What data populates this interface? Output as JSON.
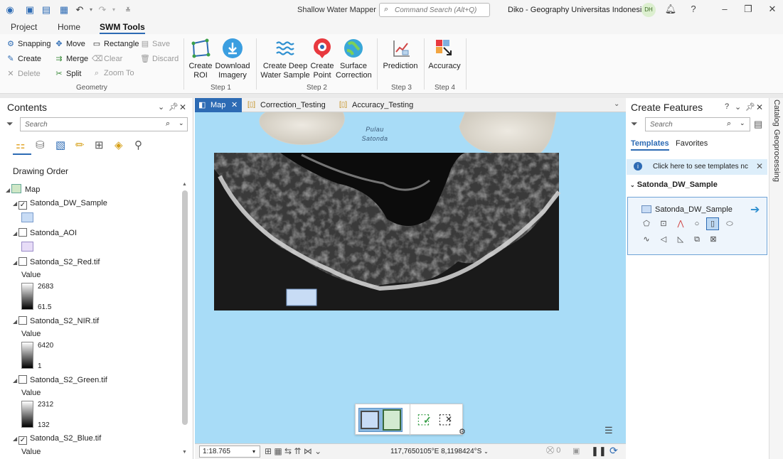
{
  "app": {
    "title": "Shallow Water Mapper",
    "command_search_placeholder": "Command Search (Alt+Q)",
    "user_name": "Diko - Geography Universitas Indonesia",
    "user_initials": "DH"
  },
  "ribbon_tabs": [
    "Project",
    "Home",
    "SWM Tools"
  ],
  "geometry_group": {
    "label": "Geometry",
    "items": [
      {
        "label": "Snapping",
        "glyph": "⚙"
      },
      {
        "label": "Move",
        "glyph": "✥"
      },
      {
        "label": "Rectangle",
        "glyph": "▭"
      },
      {
        "label": "Save",
        "glyph": "💾"
      },
      {
        "label": "Create",
        "glyph": "✎"
      },
      {
        "label": "Merge",
        "glyph": "⇉"
      },
      {
        "label": "Clear",
        "glyph": "⌫"
      },
      {
        "label": "Discard",
        "glyph": "🗑"
      },
      {
        "label": "Delete",
        "glyph": "✕"
      },
      {
        "label": "Split",
        "glyph": "✂"
      },
      {
        "label": "Zoom To",
        "glyph": "⌕"
      }
    ]
  },
  "steps": [
    {
      "label": "Step 1",
      "buttons": [
        "Create ROI",
        "Download Imagery"
      ]
    },
    {
      "label": "Step 2",
      "buttons": [
        "Create Deep Water Sample",
        "Create Point",
        "Surface Correction"
      ]
    },
    {
      "label": "Step 3",
      "buttons": [
        "Prediction"
      ]
    },
    {
      "label": "Step 4",
      "buttons": [
        "Accuracy"
      ]
    }
  ],
  "ribbon_buttons": {
    "create_roi": [
      "Create",
      "ROI"
    ],
    "download_imagery": [
      "Download",
      "Imagery"
    ],
    "create_deep_water": [
      "Create Deep",
      "Water Sample"
    ],
    "create_point": [
      "Create",
      "Point"
    ],
    "surface_correction": [
      "Surface",
      "Correction"
    ],
    "prediction": "Prediction",
    "accuracy": "Accuracy"
  },
  "contents": {
    "title": "Contents",
    "search_placeholder": "Search",
    "drawing_order_label": "Drawing Order",
    "map_label": "Map",
    "layers": [
      {
        "name": "Satonda_DW_Sample",
        "checked": true
      },
      {
        "name": "Satonda_AOI",
        "checked": false
      },
      {
        "name": "Satonda_S2_Red.tif",
        "checked": false,
        "value_label": "Value",
        "max": "2683",
        "min": "61.5"
      },
      {
        "name": "Satonda_S2_NIR.tif",
        "checked": false,
        "value_label": "Value",
        "max": "6420",
        "min": "1"
      },
      {
        "name": "Satonda_S2_Green.tif",
        "checked": false,
        "value_label": "Value",
        "max": "2312",
        "min": "132"
      },
      {
        "name": "Satonda_S2_Blue.tif",
        "checked": true,
        "value_label": "Value"
      }
    ]
  },
  "map_tabs": [
    "Map",
    "Correction_Testing",
    "Accuracy_Testing"
  ],
  "map": {
    "place_label_line1": "Pulau",
    "place_label_line2": "Satonda",
    "scale": "1:18.765",
    "coordinates": "117,7650105°E 8,1198424°S"
  },
  "create_features": {
    "title": "Create Features",
    "search_placeholder": "Search",
    "tabs": [
      "Templates",
      "Favorites"
    ],
    "info_text": "Click here to see templates nc",
    "group_name": "Satonda_DW_Sample",
    "template_name": "Satonda_DW_Sample"
  },
  "side_tabs": [
    "Catalog",
    "Geoprocessing"
  ],
  "colors": {
    "accent": "#2d6bb4",
    "water": "#a8dcf7",
    "sample_fill": "#c8dcf5"
  }
}
